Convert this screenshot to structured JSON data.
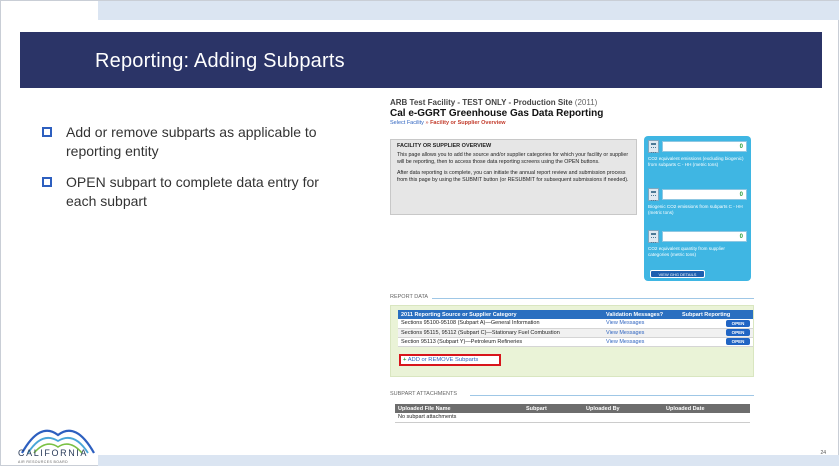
{
  "slide": {
    "title": "Reporting: Adding Subparts",
    "page_number": "24",
    "bullets": [
      "Add or remove subparts as applicable to reporting entity",
      "OPEN subpart to complete data entry for each subpart"
    ],
    "logo": {
      "text": "CALIFORNIA",
      "subtext": "AIR RESOURCES BOARD"
    }
  },
  "app": {
    "facility_line": "ARB Test Facility - TEST ONLY - Production Site",
    "facility_year": "(2011)",
    "title": "Cal e-GGRT Greenhouse Gas Data Reporting",
    "breadcrumb": {
      "link": "Select Facility",
      "separator": "»",
      "current": "Facility or Supplier Overview"
    },
    "overview": {
      "heading": "FACILITY OR SUPPLIER OVERVIEW",
      "para1": "This page allows you to add the source and/or supplier categories for which your facility or supplier will be reporting, then to access those data reporting screens using the OPEN buttons.",
      "para2": "After data reporting is complete, you can initiate the annual report review and submission process from this page by using the SUBMIT button (or RESUBMIT for subsequent submissions if needed)."
    },
    "metrics": [
      {
        "value": "0",
        "label": "CO2 equivalent emissions (excluding biogenic) from subparts C - HH (metric tons)"
      },
      {
        "value": "0",
        "label": "Biogenic CO2 emissions from subparts C - HH (metric tons)"
      },
      {
        "value": "0",
        "label": "CO2 equivalent quantity from supplier categories (metric tons)"
      }
    ],
    "ghg_button": "VIEW GHG DETAILS",
    "report_data": {
      "heading": "REPORT DATA",
      "columns": [
        "2011 Reporting Source or Supplier Category",
        "Validation Messages?",
        "Subpart Reporting"
      ],
      "rows": [
        {
          "category": "Sections 95100-95108 (Subpart A)—General Information",
          "messages": "View Messages",
          "action": "OPEN"
        },
        {
          "category": "Sections 95115, 95112 (Subpart C)—Stationary Fuel Combustion",
          "messages": "View Messages",
          "action": "OPEN"
        },
        {
          "category": "Section 95113 (Subpart Y)—Petroleum Refineries",
          "messages": "View Messages",
          "action": "OPEN"
        }
      ],
      "add_remove_link": "ADD or REMOVE Subparts"
    },
    "attachments": {
      "heading": "SUBPART ATTACHMENTS",
      "columns": [
        "Uploaded File Name",
        "Subpart",
        "Uploaded By",
        "Uploaded Date"
      ],
      "empty_text": "No subpart attachments"
    }
  },
  "colors": {
    "title_bar": "#2b3467",
    "accent_strip": "#dbe5f2",
    "bullet": "#2d5fbf",
    "link": "#2f64c0",
    "highlight": "#d8151c",
    "sidebox": "#3fb6e3"
  }
}
